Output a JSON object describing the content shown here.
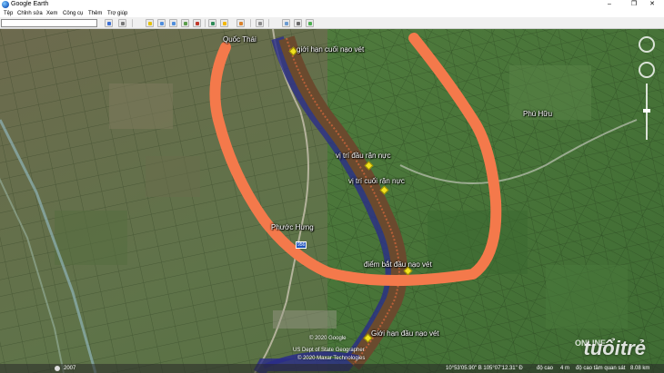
{
  "window": {
    "title": "Google Earth",
    "minimize": "–",
    "maximize": "❐",
    "close": "✕"
  },
  "menu": [
    "Tệp",
    "Chỉnh sửa",
    "Xem",
    "Công cụ",
    "Thêm",
    "Trợ giúp"
  ],
  "search": {
    "value": "",
    "placeholder": ""
  },
  "toolbar": {
    "icons": [
      "search-go-icon",
      "hide-sidebar-icon",
      "add-placemark-icon",
      "add-polygon-icon",
      "add-path-icon",
      "add-overlay-icon",
      "record-tour-icon",
      "historical-imagery-icon",
      "sun-icon",
      "planets-icon",
      "ruler-icon",
      "email-icon",
      "print-icon",
      "view-in-maps-icon"
    ]
  },
  "map": {
    "places": [
      "Quốc Thái",
      "Phú Hữu",
      "Phước Hưng"
    ],
    "road_shield": "956",
    "placemarks": [
      "giới hạn cuối nạo vét",
      "vị trí đầu rặn nực",
      "vị trí cuối rặn nực",
      "điểm bắt đầu nạo vét",
      "Giới hạn đầu nạo vét"
    ],
    "credits": [
      "© 2020 Google",
      "US Dept of State Geographer",
      "© 2020 Maxar Technologies"
    ],
    "watermark": "tuổitrẻ",
    "watermark_sub": "ONLINE"
  },
  "status": {
    "year": "2007",
    "coords": "10°53'05.90\" B  105°07'12.31\" Đ",
    "elevation_label": "độ cao",
    "elevation": "4 m",
    "eye_alt_label": "độ cao tầm quan sát",
    "eye_alt": "8.08 km"
  },
  "colors": {
    "annotation": "#f4794b",
    "river": "#6a4a2e",
    "pin": "#f2e21f"
  }
}
